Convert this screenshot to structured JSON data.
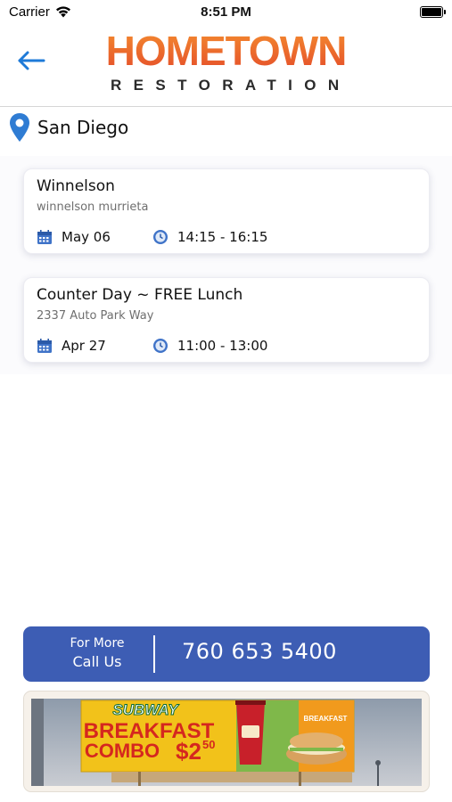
{
  "status_bar": {
    "carrier": "Carrier",
    "time": "8:51 PM"
  },
  "header": {
    "logo_top": "HOMETOWN",
    "logo_bottom": "RESTORATION",
    "back_icon": "arrow-left-icon"
  },
  "location": {
    "city": "San Diego",
    "icon": "map-pin-icon"
  },
  "events": [
    {
      "title": "Winnelson",
      "subtitle": "winnelson murrieta",
      "date": "May 06",
      "time": "14:15 - 16:15"
    },
    {
      "title": "Counter Day ~ FREE Lunch",
      "subtitle": "2337 Auto Park Way",
      "date": "Apr 27",
      "time": "11:00 - 13:00"
    }
  ],
  "call_bar": {
    "for_more": "For More",
    "call_us": "Call Us",
    "phone": "760 653 5400"
  },
  "ad": {
    "brand": "SUBWAY",
    "headline_1": "BREAKFAST",
    "headline_2": "COMBO",
    "price": "$2",
    "price_cents": "50",
    "side_label": "BREAKFAST"
  },
  "colors": {
    "accent_blue": "#3d5db4",
    "back_arrow": "#1e7ad8",
    "pin_blue": "#2f7cd3",
    "logo_orange": "#e9652b"
  }
}
